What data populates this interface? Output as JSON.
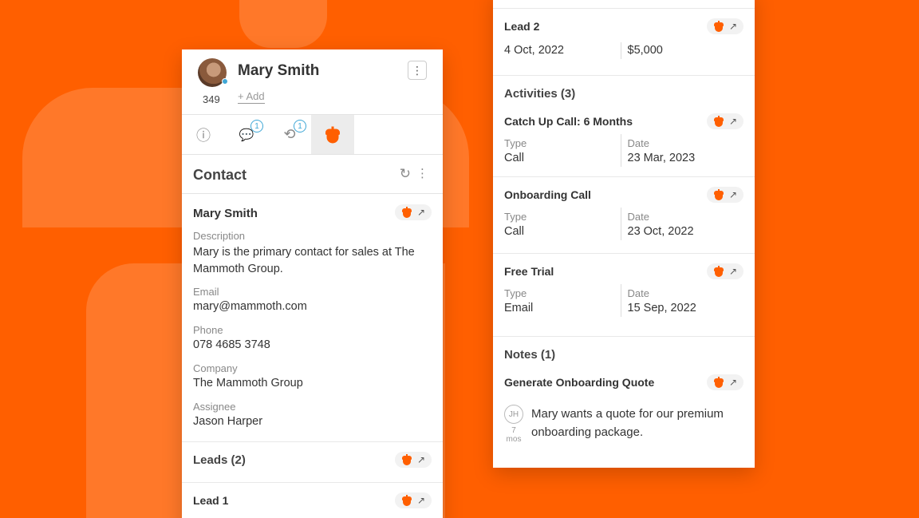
{
  "contact": {
    "name": "Mary Smith",
    "count": "349",
    "add_label": "+ Add",
    "menu_glyph": "⋮"
  },
  "tabs": [
    {
      "name": "info-icon",
      "glyph": "ⓘ",
      "badge": ""
    },
    {
      "name": "comments-icon",
      "glyph": "💬",
      "badge": "1"
    },
    {
      "name": "history-icon",
      "glyph": "⟲",
      "badge": "1"
    },
    {
      "name": "acorn-icon",
      "glyph": "",
      "badge": ""
    }
  ],
  "section": {
    "title": "Contact",
    "refresh_glyph": "↻",
    "more_glyph": "⋮"
  },
  "record": {
    "title": "Mary Smith",
    "fields": [
      {
        "label": "Description",
        "value": "Mary is the primary contact for sales at The Mammoth Group."
      },
      {
        "label": "Email",
        "value": "mary@mammoth.com"
      },
      {
        "label": "Phone",
        "value": "078 4685 3748"
      },
      {
        "label": "Company",
        "value": "The Mammoth Group"
      },
      {
        "label": "Assignee",
        "value": "Jason Harper"
      }
    ]
  },
  "leads": {
    "title": "Leads (2)",
    "items": [
      {
        "title": "Lead 1"
      },
      {
        "title": "Lead 2",
        "date": "4 Oct, 2022",
        "amount": "$5,000"
      }
    ]
  },
  "activities": {
    "title": "Activities (3)",
    "type_label": "Type",
    "date_label": "Date",
    "items": [
      {
        "title": "Catch Up Call: 6 Months",
        "type": "Call",
        "date": "23 Mar, 2023"
      },
      {
        "title": "Onboarding Call",
        "type": "Call",
        "date": "23 Oct, 2022"
      },
      {
        "title": "Free Trial",
        "type": "Email",
        "date": "15 Sep, 2022"
      }
    ]
  },
  "notes": {
    "title": "Notes (1)",
    "items": [
      {
        "title": "Generate Onboarding Quote",
        "initials": "JH",
        "ago": "7 mos",
        "text": "Mary wants a quote for our premium onboarding package."
      }
    ]
  },
  "icons": {
    "external": "↗"
  },
  "colors": {
    "brand": "#ff5f00",
    "badge": "#3fa7d6"
  }
}
